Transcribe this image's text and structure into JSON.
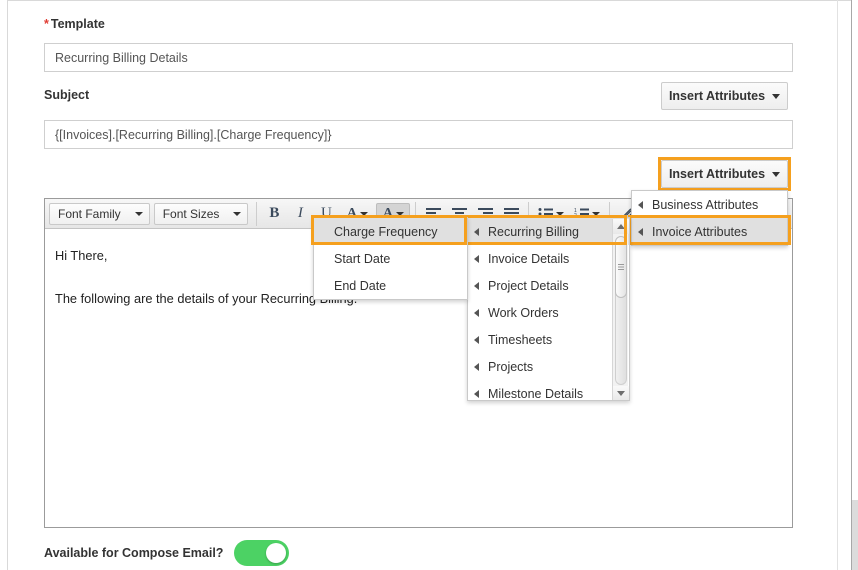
{
  "form": {
    "template_label": "Template",
    "template_required_marker": "*",
    "template_value": "Recurring Billing Details",
    "subject_label": "Subject",
    "subject_value": "{[Invoices].[Recurring Billing].[Charge Frequency]}",
    "compose_label": "Available for Compose Email?",
    "compose_toggle_state": "on"
  },
  "buttons": {
    "insert_attributes_subject": "Insert Attributes",
    "insert_attributes_body": "Insert Attributes",
    "caret_icon": "chevron-down-icon"
  },
  "editor": {
    "toolbar": {
      "font_family": "Font Family",
      "font_sizes": "Font Sizes",
      "bold": "B",
      "italic": "I",
      "underline": "U",
      "text_color": "A",
      "background_color": "A",
      "align_left": "align-left-icon",
      "align_center": "align-center-icon",
      "align_right": "align-right-icon",
      "align_justify": "align-justify-icon",
      "bullet_list": "bullet-list-icon",
      "numbered_list": "numbered-list-icon",
      "link": "link-icon"
    },
    "body": {
      "greeting": "Hi There,",
      "paragraph": "The following are the details of your Recurring Billing."
    }
  },
  "menus": {
    "level1": {
      "items": [
        {
          "label": "Business Attributes",
          "selected": false
        },
        {
          "label": "Invoice Attributes",
          "selected": true
        }
      ]
    },
    "level2": {
      "items": [
        {
          "label": "Recurring Billing",
          "selected": true
        },
        {
          "label": "Invoice Details",
          "selected": false
        },
        {
          "label": "Project Details",
          "selected": false
        },
        {
          "label": "Work Orders",
          "selected": false
        },
        {
          "label": "Timesheets",
          "selected": false
        },
        {
          "label": "Projects",
          "selected": false
        },
        {
          "label": "Milestone Details",
          "selected": false
        }
      ]
    },
    "level3": {
      "items": [
        {
          "label": "Charge Frequency",
          "selected": true
        },
        {
          "label": "Start Date",
          "selected": false
        },
        {
          "label": "End Date",
          "selected": false
        }
      ]
    }
  },
  "colors": {
    "highlight_orange": "#F5A01E",
    "toggle_green": "#4CD264",
    "required_red": "#E03B32"
  }
}
